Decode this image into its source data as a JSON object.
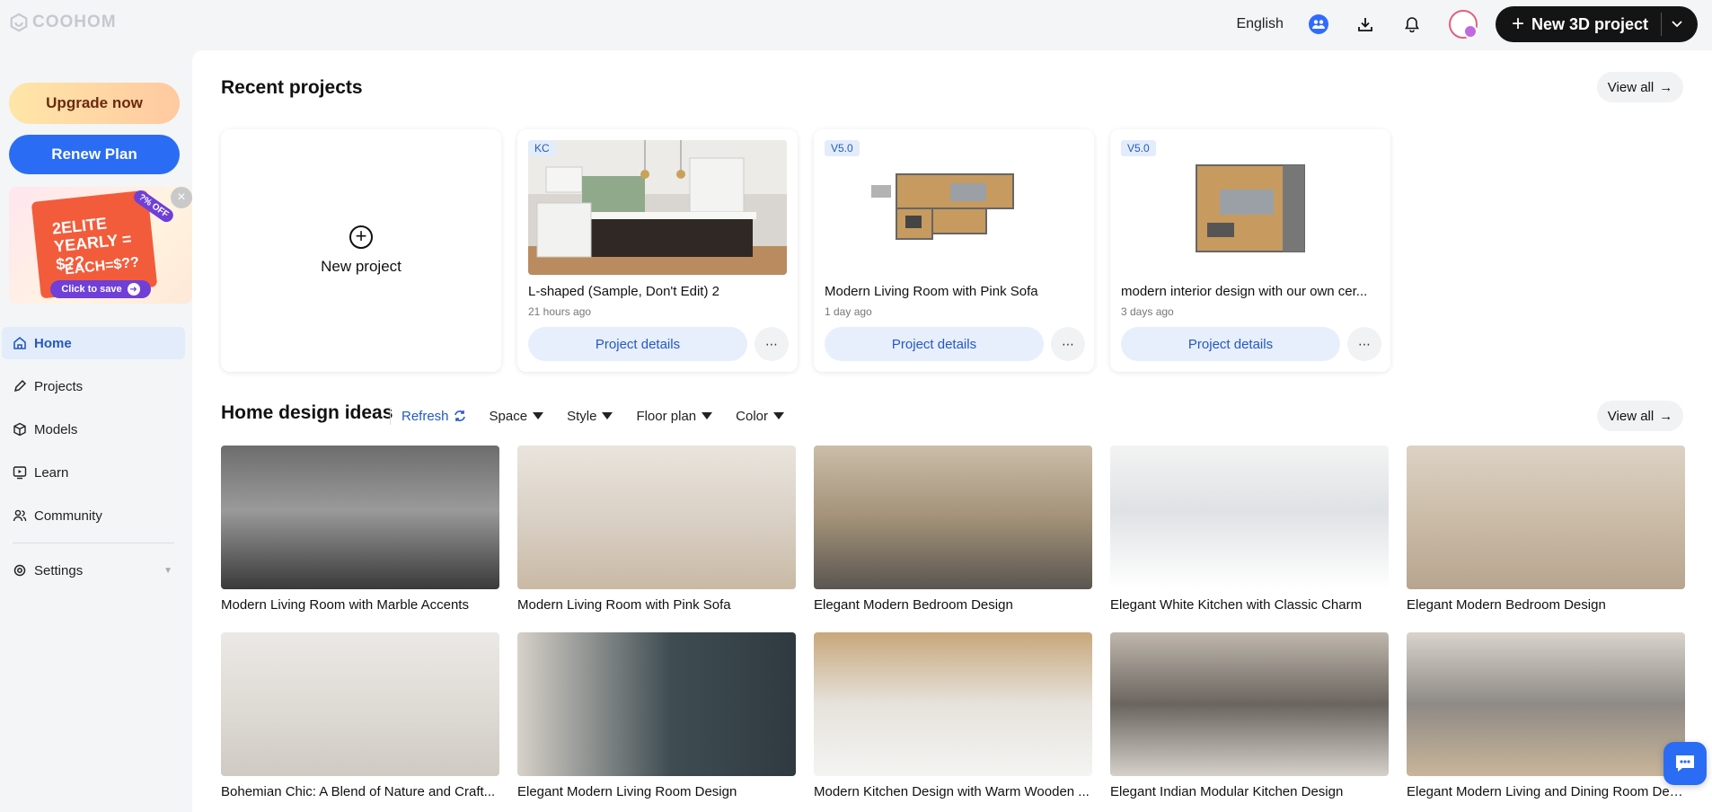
{
  "brand": {
    "name": "COOHOM"
  },
  "topbar": {
    "language": "English",
    "new_project_label": "New 3D project"
  },
  "sidebar": {
    "upgrade_label": "Upgrade now",
    "renew_label": "Renew Plan",
    "promo": {
      "headline": "2ELITE YEARLY = $??",
      "subline": "EACH=$??",
      "badge": "?% OFF",
      "cta": "Click to save"
    },
    "nav": [
      {
        "label": "Home",
        "active": true
      },
      {
        "label": "Projects"
      },
      {
        "label": "Models"
      },
      {
        "label": "Learn"
      },
      {
        "label": "Community"
      }
    ],
    "settings_label": "Settings"
  },
  "recent": {
    "title": "Recent projects",
    "view_all": "View all",
    "new_project_label": "New project",
    "projects": [
      {
        "tag": "KC",
        "name": "L-shaped (Sample, Don't Edit) 2",
        "time": "21 hours ago",
        "details": "Project details"
      },
      {
        "tag": "V5.0",
        "name": "Modern Living Room with Pink Sofa",
        "time": "1 day ago",
        "details": "Project details"
      },
      {
        "tag": "V5.0",
        "name": "modern interior design with our own cer...",
        "time": "3 days ago",
        "details": "Project details"
      }
    ]
  },
  "ideas": {
    "title": "Home design ideas",
    "refresh": "Refresh",
    "view_all": "View all",
    "filters": [
      "Space",
      "Style",
      "Floor plan",
      "Color"
    ],
    "items": [
      "Modern Living Room with Marble Accents",
      "Modern Living Room with Pink Sofa",
      "Elegant Modern Bedroom Design",
      "Elegant White Kitchen with Classic Charm",
      "Elegant Modern Bedroom Design",
      "Bohemian Chic: A Blend of Nature and Craft...",
      "Elegant Modern Living Room Design",
      "Modern Kitchen Design with Warm Wooden ...",
      "Elegant Indian Modular Kitchen Design",
      "Elegant Modern Living and Dining Room Des..."
    ]
  },
  "colors": {
    "accent": "#2a6df4",
    "active_nav_bg": "#e3ecfa",
    "dark_button": "#141414"
  }
}
